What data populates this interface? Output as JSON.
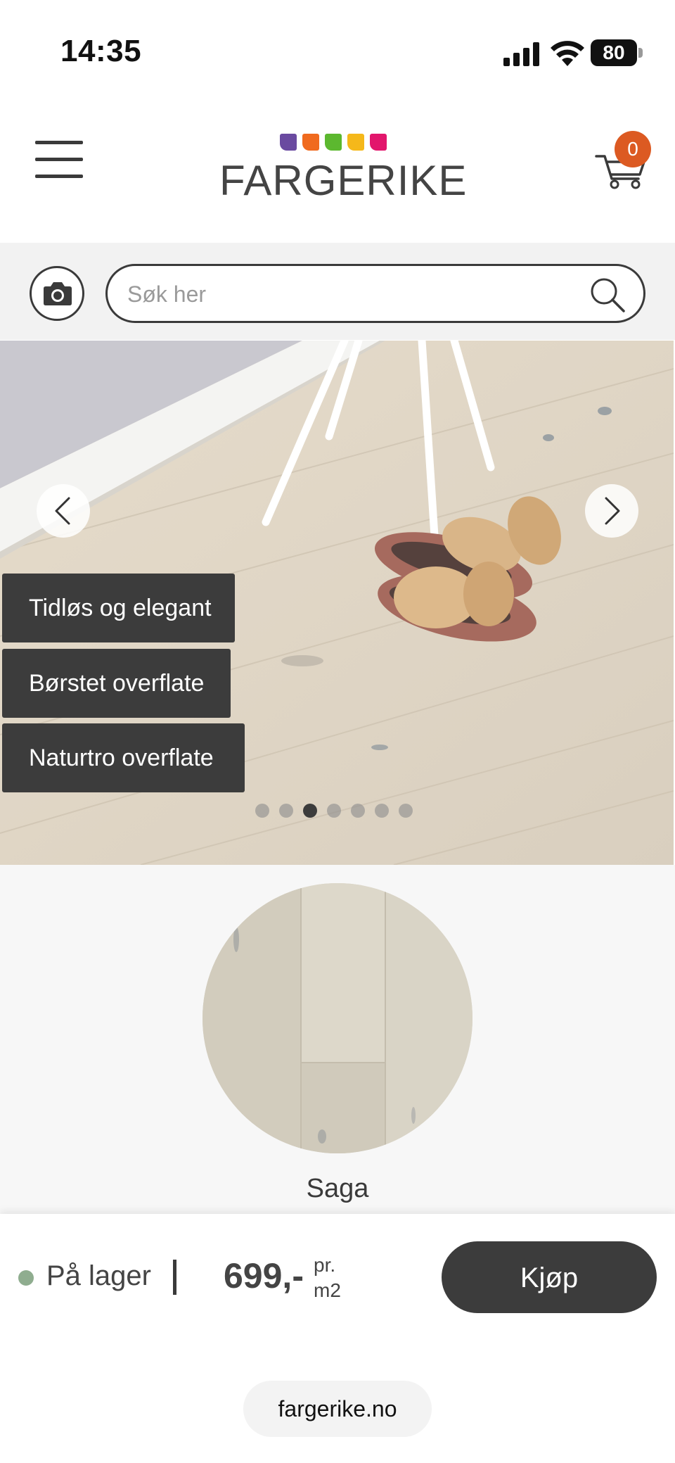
{
  "status_bar": {
    "time": "14:35",
    "battery": "80"
  },
  "header": {
    "brand": "FARGERIKE",
    "brand_colors": [
      "#6a4aa0",
      "#f06a1e",
      "#5cb82f",
      "#f5b81a",
      "#e2166c"
    ],
    "cart_count": "0",
    "accent": "#dc5a22"
  },
  "search": {
    "placeholder": "Søk her"
  },
  "hero": {
    "tags": [
      "Tidløs og elegant",
      "Børstet overflate",
      "Naturtro overflate"
    ],
    "slide_count": 7,
    "active_slide": 3
  },
  "product": {
    "name": "Saga"
  },
  "buy_bar": {
    "stock_label": "På lager",
    "price": "699,-",
    "unit_line1": "pr.",
    "unit_line2": "m2",
    "buy_label": "Kjøp",
    "stock_color": "#8fad8f"
  },
  "browser": {
    "url": "fargerike.no"
  }
}
